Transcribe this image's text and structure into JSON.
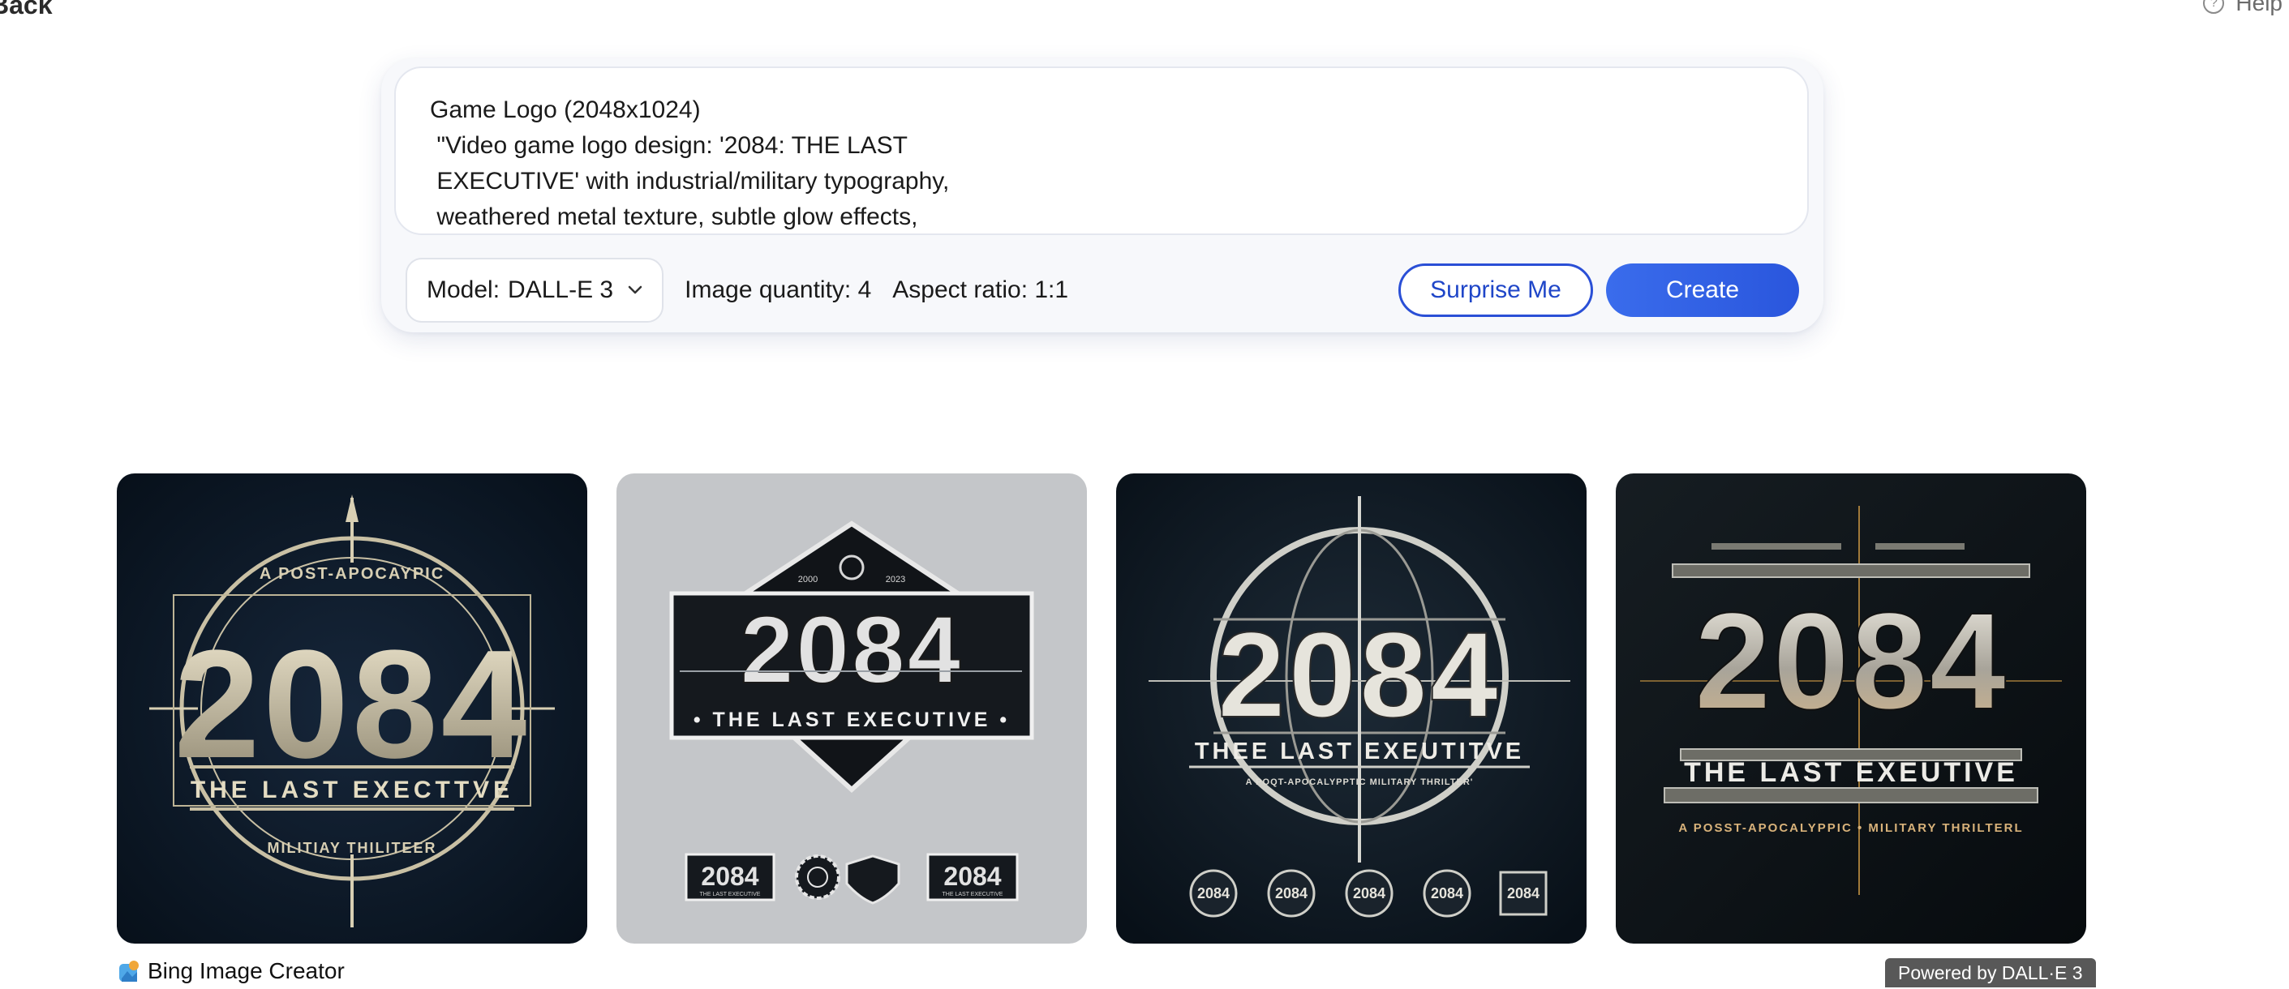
{
  "header": {
    "back_label": "Back",
    "help_label": "Help"
  },
  "prompt": {
    "text": "Game Logo (2048x1024)\n \"Video game logo design: '2084: THE LAST\n EXECUTIVE' with industrial/military typography,\n weathered metal texture, subtle glow effects,"
  },
  "controls": {
    "model_label": "Model:",
    "model_value": "DALL-E 3",
    "image_quantity": "Image quantity: 4",
    "aspect_ratio": "Aspect ratio: 1:1",
    "surprise_label": "Surprise Me",
    "create_label": "Create"
  },
  "results": [
    {
      "year": "2084",
      "arc_top": "A POST-APOCAYPIC",
      "subtitle": "THE LAST EXECTTVE",
      "arc_bottom": "MILITIAY THILITEER",
      "background": "#0b1622"
    },
    {
      "year": "2084",
      "dates": [
        "2000",
        "2023"
      ],
      "subtitle": "• THE LAST EXECUTIVE •",
      "background": "#c4c6c9",
      "badges": [
        "2084",
        "2084"
      ],
      "badge_sub": "THE LAST EXECUTIVE"
    },
    {
      "year": "2084",
      "subtitle": "THEE LAST EXEUTITVE",
      "tagline": "A POQT-APOCALYPPTIC MILITARY THRILTER'",
      "background": "#0d1a26",
      "medallions": [
        "2084",
        "2084",
        "2084",
        "2084",
        "2084"
      ]
    },
    {
      "year": "2084",
      "subtitle": "THE LAST EXEUTIVE",
      "tagline": "A POSST-APOCALYPPIC • MILITARY THRILTERL",
      "background": "#0e1418"
    }
  ],
  "footer": {
    "brand_label": "Bing Image Creator",
    "powered_label": "Powered by DALL·E 3"
  },
  "colors": {
    "accent": "#2a56dd",
    "surprise_border": "#2a4fd6",
    "metal": "#d8d2c0"
  }
}
